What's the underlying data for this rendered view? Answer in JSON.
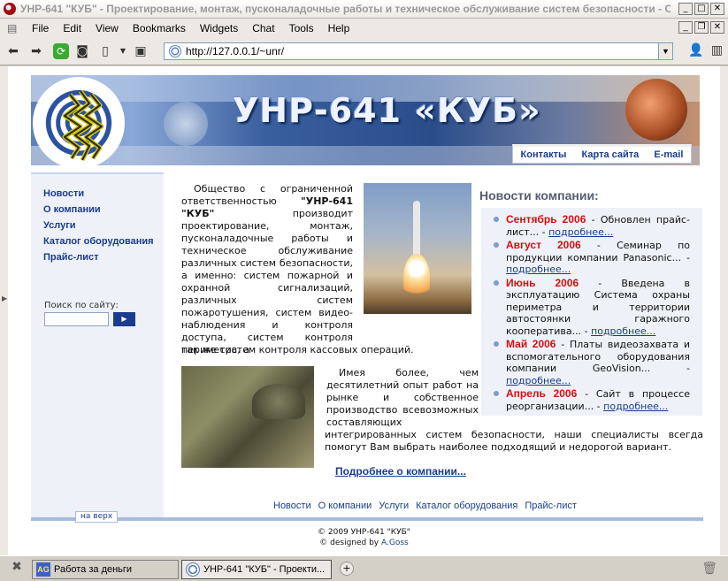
{
  "window": {
    "title": "УНР-641 \"КУБ\" - Проектирование, монтаж, пусконаладочные работы и техническое обслуживание систем безопасности - О...",
    "min": "_",
    "max": "□",
    "close": "✕"
  },
  "menu": [
    "File",
    "Edit",
    "View",
    "Bookmarks",
    "Widgets",
    "Chat",
    "Tools",
    "Help"
  ],
  "address": {
    "url": "http://127.0.0.1/~unr/"
  },
  "site": {
    "title": "УНР-641 «КУБ»",
    "top_links": [
      "Контакты",
      "Карта сайта",
      "E-mail"
    ]
  },
  "sidebar": {
    "items": [
      "Новости",
      "О компании",
      "Услуги",
      "Каталог оборудования",
      "Прайс-лист"
    ],
    "search_label": "Поиск по сайту:",
    "search_value": "",
    "search_button": "▶"
  },
  "content": {
    "intro_pre": "Общество с ограниченной ответственностью ",
    "intro_name": "\"УНР-641 \"КУБ\"",
    "intro_post": " производит проектирование, монтаж, пусконаладочные работы и техническое обслуживание различных систем безопасности, а именно: систем пожарной и охранной сигнализаций, различных систем пожаротушения, систем видео-наблюдения и контроля доступа, систем контроля периметра, а",
    "intro_tail": "так же систем контроля кассовых операций.",
    "experience": "Имея более, чем десятилетний опыт работ на рынке и собственное производство всевозможных составляющих",
    "experience_tail": "интегрированных систем безопасности, наши специалисты всегда помогут Вам выбрать наиболее подходящий и недорогой вариант.",
    "more_link": "Подробнее о компании..."
  },
  "news": {
    "title": "Новости компании:",
    "items": [
      {
        "date": "Сентябрь 2006",
        "text": " - Обновлен прайс-лист... - ",
        "more": "подробнее..."
      },
      {
        "date": "Август 2006",
        "text": " - Семинар по продукции компании Panasonic... - ",
        "more": "подробнее..."
      },
      {
        "date": "Июнь 2006",
        "text": " - Введена в эксплуатацию Система охраны периметра и территории автостоянки гаражного кооператива... - ",
        "more": "подробнее..."
      },
      {
        "date": "Май 2006",
        "text": " - Платы видеозахвата и вспомогательного оборудования компании GeoVision... - ",
        "more": "подробнее..."
      },
      {
        "date": "Апрель 2006",
        "text": " - Сайт в процессе реорганизации... - ",
        "more": "подробнее..."
      }
    ]
  },
  "footer": {
    "nav": [
      "Новости",
      "О компании",
      "Услуги",
      "Каталог оборудования",
      "Прайс-лист"
    ],
    "to_top": "на верх",
    "copyright": "© 2009 УНР-641 \"КУБ\"",
    "designed_by": "© designed by ",
    "author": "A.Goss"
  },
  "taskbar": {
    "tasks": [
      "Работа за деньги",
      "УНР-641 \"КУБ\" - Проекти..."
    ],
    "task1_icon": "AG"
  },
  "colors": {
    "link": "#1a3c8e",
    "news_date": "#d21010",
    "sidebar_bg": "#eef1f7"
  }
}
